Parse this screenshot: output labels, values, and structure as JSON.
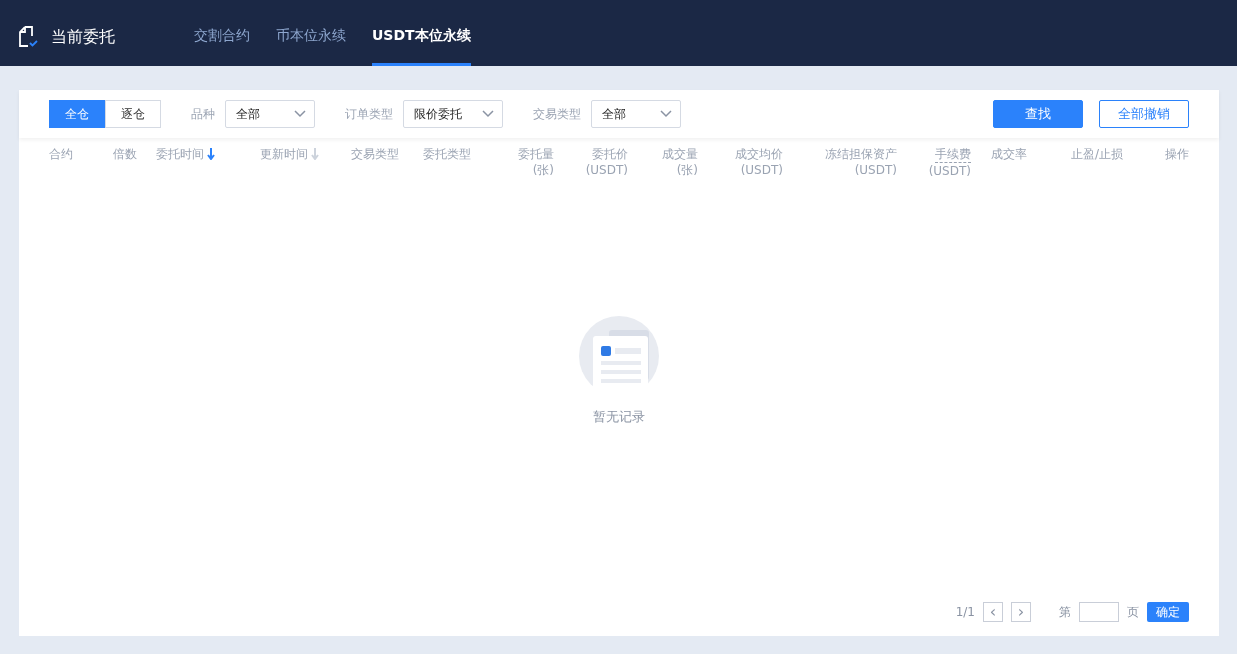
{
  "header": {
    "title": "当前委托",
    "tabs": [
      {
        "label": "交割合约",
        "selected": false
      },
      {
        "label": "币本位永续",
        "selected": false
      },
      {
        "label": "USDT本位永续",
        "selected": true
      }
    ]
  },
  "toolbar": {
    "mode_toggle": [
      {
        "label": "全仓",
        "selected": true
      },
      {
        "label": "逐仓",
        "selected": false
      }
    ],
    "filters": [
      {
        "label": "品种",
        "value": "全部"
      },
      {
        "label": "订单类型",
        "value": "限价委托"
      },
      {
        "label": "交易类型",
        "value": "全部"
      }
    ],
    "buttons": [
      {
        "label": "查找",
        "kind": "primary"
      },
      {
        "label": "全部撤销",
        "kind": "outline"
      }
    ]
  },
  "table": {
    "columns": [
      {
        "label": "合约"
      },
      {
        "label": "倍数"
      },
      {
        "label": "委托时间",
        "sorted": true
      },
      {
        "label": "更新时间",
        "sorted": false
      },
      {
        "label": "交易类型"
      },
      {
        "label": "委托类型"
      },
      {
        "label": "委托量",
        "unit": "(张)"
      },
      {
        "label": "委托价",
        "unit": "(USDT)"
      },
      {
        "label": "成交量",
        "unit": "(张)"
      },
      {
        "label": "成交均价",
        "unit": "(USDT)"
      },
      {
        "label": "冻结担保资产",
        "unit": "(USDT)"
      },
      {
        "label": "手续费",
        "unit": "(USDT)",
        "has_tip": true
      },
      {
        "label": "成交率"
      },
      {
        "label": "止盈/止损"
      },
      {
        "label": "操作"
      }
    ],
    "empty_text": "暂无记录"
  },
  "pagination": {
    "page_info": "1/1",
    "prev_label": "‹",
    "next_label": "›",
    "page_prefix": "第",
    "page_suffix": "页",
    "confirm": "确定"
  }
}
